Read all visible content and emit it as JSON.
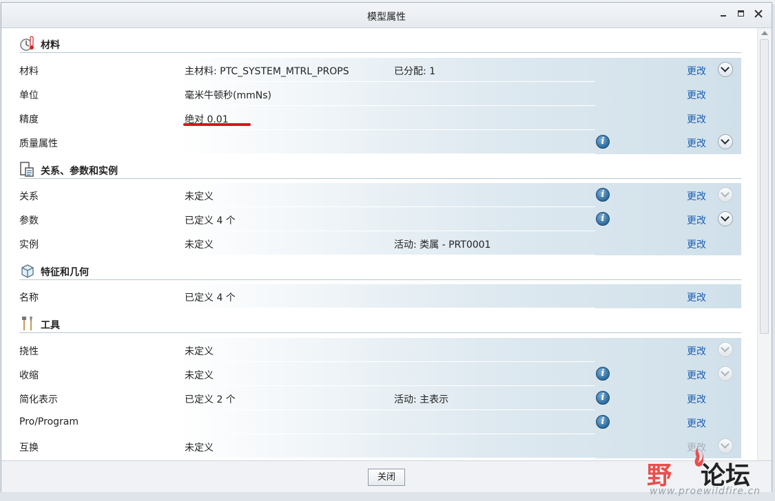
{
  "window": {
    "title": "模型属性"
  },
  "sections": [
    {
      "title": "材料",
      "icon": "material-icon"
    },
    {
      "title": "关系、参数和实例",
      "icon": "relations-icon"
    },
    {
      "title": "特征和几何",
      "icon": "feature-cube-icon"
    },
    {
      "title": "工具",
      "icon": "tools-icon"
    }
  ],
  "rows": [
    {
      "label": "材料",
      "value": "主材料: PTC_SYSTEM_MTRL_PROPS",
      "extra": "已分配: 1",
      "change": "更改",
      "info": false,
      "expand": "active"
    },
    {
      "label": "单位",
      "value": "毫米牛顿秒(mmNs)",
      "extra": "",
      "change": "更改",
      "info": false,
      "expand": "none"
    },
    {
      "label": "精度",
      "value": "绝对 0.01",
      "extra": "",
      "change": "更改",
      "info": false,
      "expand": "none"
    },
    {
      "label": "质量属性",
      "value": "",
      "extra": "",
      "change": "更改",
      "info": true,
      "expand": "active"
    },
    {
      "label": "关系",
      "value": "未定义",
      "extra": "",
      "change": "更改",
      "info": true,
      "expand": "dim"
    },
    {
      "label": "参数",
      "value": "已定义 4 个",
      "extra": "",
      "change": "更改",
      "info": true,
      "expand": "active"
    },
    {
      "label": "实例",
      "value": "未定义",
      "extra": "活动: 类属 - PRT0001",
      "change": "更改",
      "info": false,
      "expand": "none"
    },
    {
      "label": "名称",
      "value": "已定义 4 个",
      "extra": "",
      "change": "更改",
      "info": false,
      "expand": "none"
    },
    {
      "label": "挠性",
      "value": "未定义",
      "extra": "",
      "change": "更改",
      "info": false,
      "expand": "dim"
    },
    {
      "label": "收缩",
      "value": "未定义",
      "extra": "",
      "change": "更改",
      "info": true,
      "expand": "dim"
    },
    {
      "label": "简化表示",
      "value": "已定义 2 个",
      "extra": "活动: 主表示",
      "change": "更改",
      "info": true,
      "expand": "none"
    },
    {
      "label": "Pro/Program",
      "value": "",
      "extra": "",
      "change": "更改",
      "info": true,
      "expand": "none"
    },
    {
      "label": "互换",
      "value": "未定义",
      "extra": "",
      "change": "更改",
      "info": false,
      "expand": "dim",
      "change_disabled": true
    }
  ],
  "info_glyph": "i",
  "footer": {
    "close_label": "关闭"
  },
  "watermark": {
    "brand_left": "野",
    "brand_right": "论坛",
    "url": "www.proewildfire.cn"
  },
  "colors": {
    "link": "#1a5fb4",
    "annotation": "#d9141b",
    "disabled": "#aab3bd"
  }
}
